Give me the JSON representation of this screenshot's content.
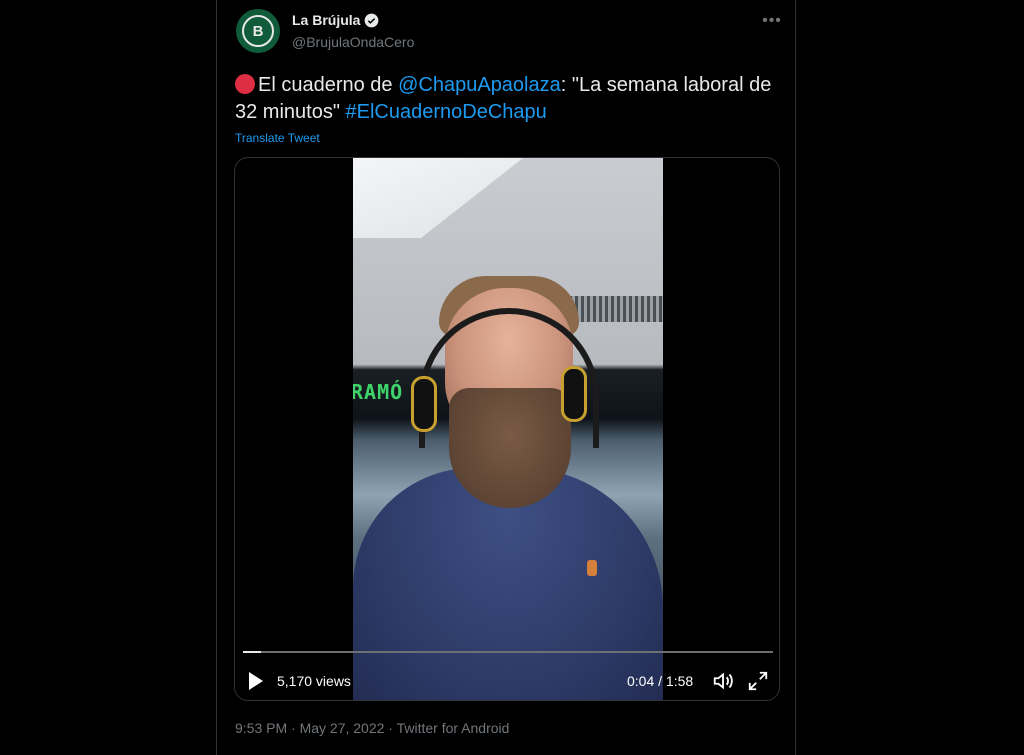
{
  "tweet": {
    "display_name": "La Brújula",
    "handle": "@BrujulaOndaCero",
    "avatar_letter": "B",
    "text_before": "El cuaderno de ",
    "mention": "@ChapuApaolaza",
    "text_middle": ": \"La semana laboral de 32 minutos\" ",
    "hashtag": "#ElCuadernoDeChapu",
    "translate_label": "Translate Tweet",
    "meta": "9:53 PM · May 27, 2022 · Twitter for Android"
  },
  "video": {
    "views": "5,170 views",
    "time": "0:04 / 1:58",
    "progress_fraction": 0.034,
    "sign_text": "RAMÓ"
  },
  "icons": {
    "verified": "verified-badge-icon",
    "more": "more-horizontal-icon",
    "play": "play-icon",
    "volume": "volume-icon",
    "fullscreen": "fullscreen-icon"
  },
  "colors": {
    "background": "#000000",
    "link": "#1d9bf0",
    "muted": "#71767b",
    "text": "#e7e9ea",
    "avatar": "#0f5b3a"
  }
}
